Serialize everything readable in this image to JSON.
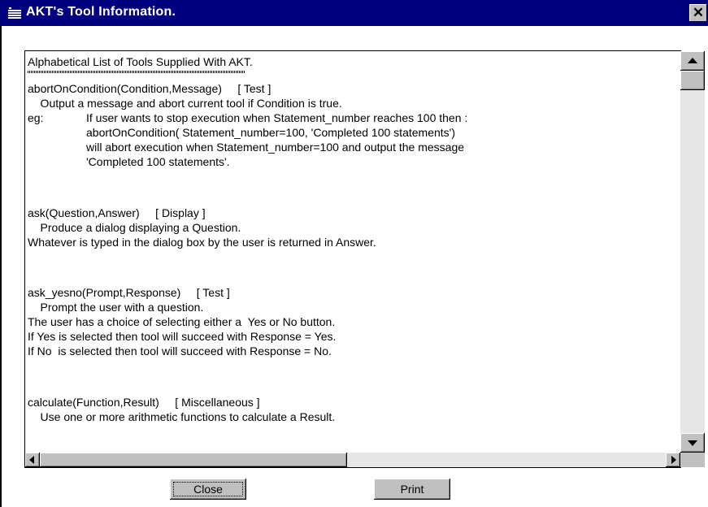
{
  "window": {
    "title": "AKT's Tool Information.",
    "app_icon": "window-app-icon",
    "close_glyph": "✕"
  },
  "text_content": {
    "heading": "Alphabetical List of Tools Supplied With AKT.",
    "lines": [
      "abortOnCondition(Condition,Message)     [ Test ]",
      "    Output a message and abort current tool if Condition is true.",
      "eg:",
      "If user wants to stop execution when Statement_number reaches 100 then :",
      "abortOnCondition( Statement_number=100, 'Completed 100 statements')",
      "will abort execution when Statement_number=100 and output the message",
      "'Completed 100 statements'.",
      "ask(Question,Answer)     [ Display ]",
      "    Produce a dialog displaying a Question.",
      "Whatever is typed in the dialog box by the user is returned in Answer.",
      "ask_yesno(Prompt,Response)     [ Test ]",
      "    Prompt the user with a question.",
      "The user has a choice of selecting either a  Yes or No button.",
      "If Yes is selected then tool will succeed with Response = Yes.",
      "If No  is selected then tool will succeed with Response = No.",
      "calculate(Function,Result)     [ Miscellaneous ]",
      "    Use one or more arithmetic functions to calculate a Result."
    ]
  },
  "buttons": {
    "close_label": "Close",
    "print_label": "Print"
  },
  "icons": {
    "up": "scroll-up-arrow-icon",
    "down": "scroll-down-arrow-icon",
    "left": "scroll-left-arrow-icon",
    "right": "scroll-right-arrow-icon"
  }
}
